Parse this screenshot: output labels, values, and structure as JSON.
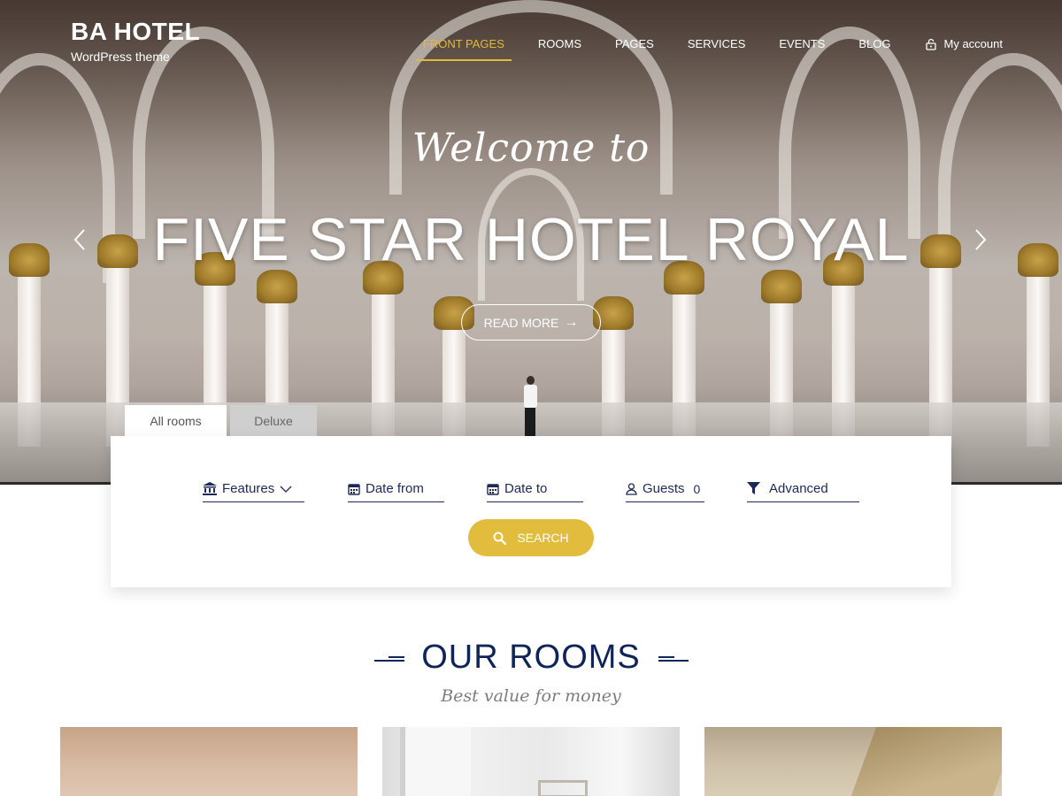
{
  "brand": {
    "title": "BA HOTEL",
    "subtitle": "WordPress theme"
  },
  "nav": {
    "items": [
      {
        "label": "FRONT PAGES",
        "active": true
      },
      {
        "label": "ROOMS"
      },
      {
        "label": "PAGES"
      },
      {
        "label": "SERVICES"
      },
      {
        "label": "EVENTS"
      },
      {
        "label": "BLOG"
      }
    ],
    "account_label": "My account",
    "account_icon": "lock-icon"
  },
  "hero": {
    "welcome": "Welcome to",
    "headline": "FIVE STAR HOTEL ROYAL",
    "cta_label": "READ MORE",
    "cta_icon": "arrow-right-icon",
    "prev_icon": "chevron-left-icon",
    "next_icon": "chevron-right-icon"
  },
  "search": {
    "tabs": [
      {
        "label": "All rooms",
        "active": true
      },
      {
        "label": "Deluxe"
      }
    ],
    "fields": {
      "features": {
        "label": "Features",
        "icon": "bank-icon"
      },
      "date_from": {
        "label": "Date from",
        "icon": "calendar-icon"
      },
      "date_to": {
        "label": "Date to",
        "icon": "calendar-icon"
      },
      "guests": {
        "label": "Guests",
        "value": "0",
        "icon": "user-icon"
      },
      "advanced": {
        "label": "Advanced",
        "icon": "filter-icon"
      }
    },
    "button_label": "SEARCH",
    "button_icon": "search-icon"
  },
  "rooms_section": {
    "title": "OUR ROOMS",
    "subtitle": "Best value for money"
  },
  "colors": {
    "accent": "#e2bc3c",
    "navy": "#0f2557",
    "nav_active": "#e2b93b"
  }
}
